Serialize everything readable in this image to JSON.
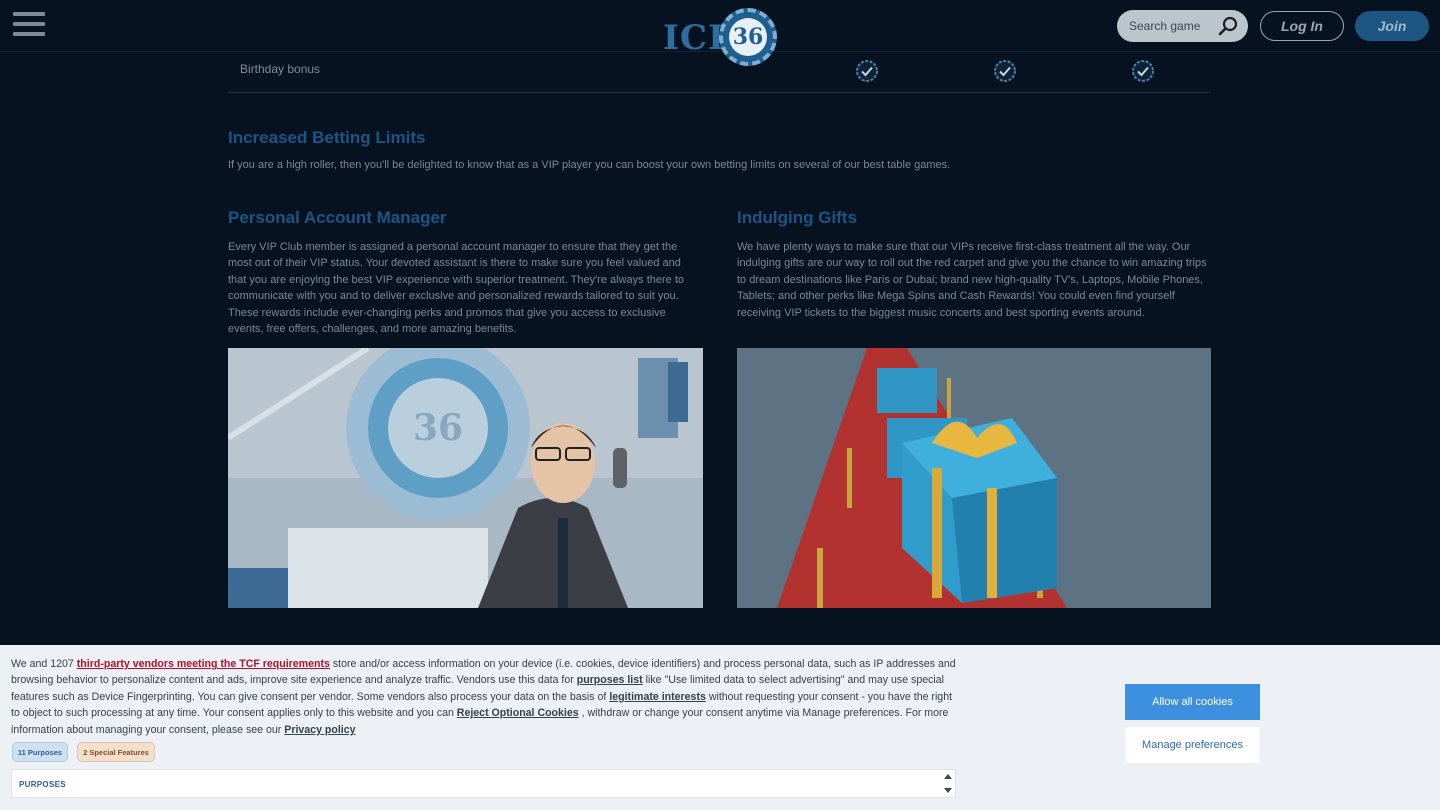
{
  "header": {
    "logo_text": "ICE",
    "logo_number": "36",
    "search_placeholder": "Search game",
    "login_label": "Log In",
    "join_label": "Join"
  },
  "table": {
    "row_label": "Birthday bonus",
    "check_count": 3
  },
  "sections": {
    "betting": {
      "title": "Increased Betting Limits",
      "body": "If you are a high roller, then you'll be delighted to know that as a VIP player you can boost your own betting limits on several of our best table games."
    },
    "manager": {
      "title": "Personal Account Manager",
      "body": "Every VIP Club member is assigned a personal account manager to ensure that they get the most out of their VIP status. Your devoted assistant is there to make sure you feel valued and that you are enjoying the best VIP experience with superior treatment. They're always there to communicate with you and to deliver exclusive and personalized rewards tailored to suit you. These rewards include ever-changing perks and promos that give you access to exclusive events, free offers, challenges, and more amazing benefits."
    },
    "gifts": {
      "title": "Indulging Gifts",
      "body": "We have plenty ways to make sure that our VIPs receive first-class treatment all the way. Our indulging gifts are our way to roll out the red carpet and give you the chance to win amazing trips to dream destinations like Paris or Dubai; brand new high-quality TV's, Laptops, Mobile Phones, Tablets; and other perks like Mega Spins and Cash Rewards! You could even find yourself receiving VIP tickets to the biggest music concerts and best sporting events around."
    }
  },
  "cookie": {
    "t1": "We and 1207 ",
    "link_vendors": "third-party vendors meeting the TCF requirements",
    "t2": " store and/or access information on your device (i.e. cookies, device identifiers) and process personal data, such as IP addresses and browsing behavior to personalize content and ads, improve site experience and analyze traffic. Vendors use this data for ",
    "link_purposes": "purposes list",
    "t3": "  like \"Use limited data to select advertising\" and may use special features such as Device Fingerprinting. You can give consent per vendor. Some vendors also process your data on the basis of ",
    "link_legit": "legitimate interests",
    "t4": "  without requesting your consent - you have the right to object to such processing at any time. Your consent applies only to this website and you can ",
    "link_reject": "Reject Optional Cookies",
    "t5": " , withdraw or change your consent anytime via Manage preferences. For more information about managing your consent, please see our ",
    "link_privacy": "Privacy policy",
    "badge_purposes": "11 Purposes",
    "badge_special": "2 Special Features",
    "purposes_heading": "PURPOSES",
    "allow_label": "Allow all cookies",
    "manage_label": "Manage preferences"
  },
  "colors": {
    "background": "#06121f",
    "heading": "#1b5585",
    "accent": "#3d8fe0"
  }
}
